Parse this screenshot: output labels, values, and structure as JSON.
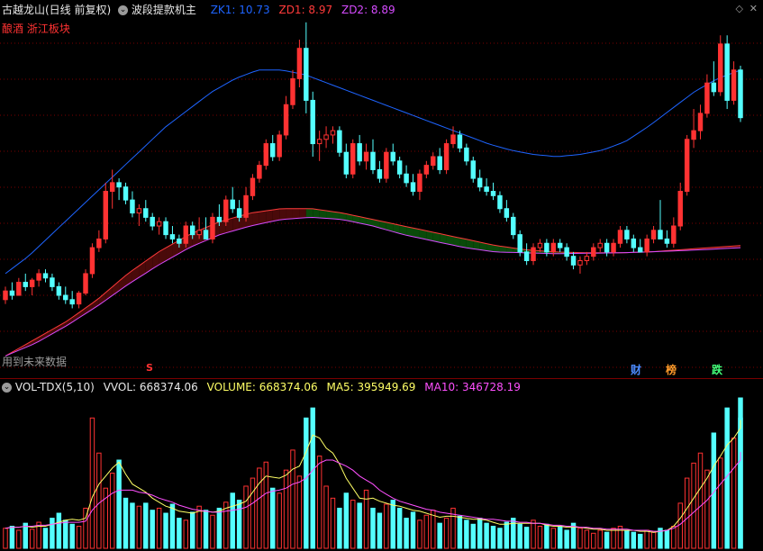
{
  "main_header": {
    "stock_title": "古越龙山(日线 前复权)",
    "indicator_name": "波段提款机主",
    "zk1_label": "ZK1: ",
    "zk1_value": "10.73",
    "zd1_label": "ZD1: ",
    "zd1_value": "8.97",
    "zd2_label": "ZD2: ",
    "zd2_value": "8.89",
    "sector_tag": "酿酒 浙江板块",
    "footnote": "用到未来数据",
    "marker_s": "S"
  },
  "event_badges": [
    {
      "label": "财",
      "color": "#4b8bff"
    },
    {
      "label": "榜",
      "color": "#ff9a2a"
    },
    {
      "label": "跌",
      "color": "#43ff7a"
    }
  ],
  "volume_header": {
    "name": "VOL-TDX(5,10)",
    "vvol_label": "VVOL: ",
    "vvol_value": "668374.06",
    "volume_label": "VOLUME: ",
    "volume_value": "668374.06",
    "ma5_label": "MA5: ",
    "ma5_value": "395949.69",
    "ma10_label": "MA10: ",
    "ma10_value": "346728.19"
  },
  "colors": {
    "up": "#ff3232",
    "down": "#54ffff",
    "zk1": "#1e64ff",
    "zd1": "#ff3a3a",
    "zd2": "#d64bff",
    "ma5": "#ffff66",
    "ma10": "#ff50ff",
    "band_up": "#4a0a0a",
    "band_down": "#0a4a0a",
    "grid": "#7a0000"
  },
  "chart_data": {
    "type": "candlestick",
    "candles": [
      [
        5.9,
        6.2,
        5.8,
        6.1
      ],
      [
        6.1,
        6.3,
        5.9,
        6.0
      ],
      [
        6.0,
        6.4,
        6.0,
        6.3
      ],
      [
        6.3,
        6.5,
        6.1,
        6.2
      ],
      [
        6.2,
        6.4,
        6.0,
        6.35
      ],
      [
        6.35,
        6.6,
        6.2,
        6.5
      ],
      [
        6.5,
        6.6,
        6.3,
        6.4
      ],
      [
        6.4,
        6.5,
        6.1,
        6.2
      ],
      [
        6.2,
        6.3,
        5.9,
        6.0
      ],
      [
        6.0,
        6.2,
        5.8,
        5.9
      ],
      [
        5.9,
        6.1,
        5.7,
        5.8
      ],
      [
        5.8,
        6.1,
        5.7,
        6.05
      ],
      [
        6.05,
        6.6,
        6.0,
        6.5
      ],
      [
        6.5,
        7.2,
        6.4,
        7.1
      ],
      [
        7.1,
        7.5,
        7.0,
        7.3
      ],
      [
        7.3,
        8.6,
        7.2,
        8.4
      ],
      [
        8.4,
        8.9,
        8.0,
        8.6
      ],
      [
        8.6,
        8.7,
        8.2,
        8.5
      ],
      [
        8.5,
        8.6,
        8.1,
        8.2
      ],
      [
        8.2,
        8.4,
        7.8,
        7.9
      ],
      [
        7.9,
        8.1,
        7.6,
        8.0
      ],
      [
        8.0,
        8.2,
        7.7,
        7.8
      ],
      [
        7.8,
        7.9,
        7.5,
        7.6
      ],
      [
        7.6,
        7.8,
        7.4,
        7.7
      ],
      [
        7.7,
        7.8,
        7.3,
        7.4
      ],
      [
        7.4,
        7.6,
        7.2,
        7.3
      ],
      [
        7.3,
        7.4,
        7.1,
        7.2
      ],
      [
        7.2,
        7.7,
        7.1,
        7.6
      ],
      [
        7.6,
        7.7,
        7.3,
        7.4
      ],
      [
        7.4,
        7.8,
        7.3,
        7.5
      ],
      [
        7.5,
        7.8,
        7.4,
        7.3
      ],
      [
        7.3,
        7.9,
        7.2,
        7.8
      ],
      [
        7.8,
        8.1,
        7.6,
        7.7
      ],
      [
        7.7,
        8.3,
        7.6,
        8.2
      ],
      [
        8.2,
        8.5,
        7.9,
        8.0
      ],
      [
        8.0,
        8.2,
        7.7,
        7.8
      ],
      [
        7.8,
        8.5,
        7.7,
        8.3
      ],
      [
        8.3,
        8.8,
        8.2,
        8.7
      ],
      [
        8.7,
        9.1,
        8.6,
        9.0
      ],
      [
        9.0,
        9.6,
        8.9,
        9.5
      ],
      [
        9.5,
        9.7,
        9.1,
        9.2
      ],
      [
        9.2,
        9.8,
        9.1,
        9.7
      ],
      [
        9.7,
        10.6,
        9.6,
        10.4
      ],
      [
        10.4,
        11.2,
        10.3,
        11.0
      ],
      [
        11.0,
        11.9,
        10.8,
        11.7
      ],
      [
        11.7,
        12.3,
        10.2,
        10.5
      ],
      [
        10.5,
        10.7,
        9.2,
        9.5
      ],
      [
        9.5,
        9.8,
        9.1,
        9.6
      ],
      [
        9.6,
        9.9,
        9.4,
        9.7
      ],
      [
        9.7,
        9.9,
        9.5,
        9.8
      ],
      [
        9.8,
        9.9,
        9.2,
        9.3
      ],
      [
        9.3,
        9.5,
        8.7,
        8.8
      ],
      [
        8.8,
        9.6,
        8.7,
        9.5
      ],
      [
        9.5,
        9.7,
        9.0,
        9.1
      ],
      [
        9.1,
        9.5,
        8.9,
        9.3
      ],
      [
        9.3,
        9.6,
        8.8,
        8.9
      ],
      [
        8.9,
        9.1,
        8.6,
        8.7
      ],
      [
        8.7,
        9.4,
        8.6,
        9.3
      ],
      [
        9.3,
        9.5,
        9.0,
        9.1
      ],
      [
        9.1,
        9.2,
        8.7,
        8.8
      ],
      [
        8.8,
        9.0,
        8.5,
        8.6
      ],
      [
        8.6,
        8.8,
        8.3,
        8.4
      ],
      [
        8.4,
        8.9,
        8.2,
        8.8
      ],
      [
        8.8,
        9.1,
        8.7,
        9.0
      ],
      [
        9.0,
        9.3,
        8.9,
        9.2
      ],
      [
        9.2,
        9.4,
        8.8,
        8.9
      ],
      [
        8.9,
        9.6,
        8.8,
        9.5
      ],
      [
        9.5,
        9.9,
        9.4,
        9.7
      ],
      [
        9.7,
        9.8,
        9.3,
        9.4
      ],
      [
        9.4,
        9.5,
        9.0,
        9.1
      ],
      [
        9.1,
        9.2,
        8.6,
        8.7
      ],
      [
        8.7,
        8.9,
        8.4,
        8.5
      ],
      [
        8.5,
        8.7,
        8.3,
        8.4
      ],
      [
        8.4,
        8.6,
        8.2,
        8.3
      ],
      [
        8.3,
        8.4,
        7.9,
        8.0
      ],
      [
        8.0,
        8.2,
        7.7,
        7.8
      ],
      [
        7.8,
        7.9,
        7.3,
        7.4
      ],
      [
        7.4,
        7.5,
        6.9,
        7.0
      ],
      [
        7.0,
        7.2,
        6.7,
        6.8
      ],
      [
        6.8,
        7.2,
        6.7,
        7.1
      ],
      [
        7.1,
        7.3,
        7.0,
        7.2
      ],
      [
        7.2,
        7.3,
        6.9,
        7.0
      ],
      [
        7.0,
        7.3,
        6.9,
        7.2
      ],
      [
        7.2,
        7.3,
        7.0,
        7.1
      ],
      [
        7.1,
        7.2,
        6.8,
        6.9
      ],
      [
        6.9,
        7.0,
        6.6,
        6.7
      ],
      [
        6.7,
        6.9,
        6.5,
        6.8
      ],
      [
        6.8,
        7.0,
        6.7,
        6.9
      ],
      [
        6.9,
        7.2,
        6.8,
        7.1
      ],
      [
        7.1,
        7.3,
        7.0,
        7.2
      ],
      [
        7.2,
        7.3,
        6.9,
        7.0
      ],
      [
        7.0,
        7.3,
        6.9,
        7.2
      ],
      [
        7.2,
        7.6,
        7.1,
        7.5
      ],
      [
        7.5,
        7.6,
        7.2,
        7.3
      ],
      [
        7.3,
        7.4,
        7.0,
        7.1
      ],
      [
        7.1,
        7.3,
        7.0,
        7.0
      ],
      [
        7.0,
        7.4,
        6.9,
        7.3
      ],
      [
        7.3,
        7.6,
        7.2,
        7.5
      ],
      [
        7.5,
        8.2,
        7.4,
        7.3
      ],
      [
        7.3,
        7.5,
        7.1,
        7.2
      ],
      [
        7.2,
        7.8,
        7.1,
        7.6
      ],
      [
        7.6,
        8.6,
        7.5,
        8.4
      ],
      [
        8.4,
        9.7,
        8.3,
        9.6
      ],
      [
        9.6,
        10.3,
        9.4,
        9.8
      ],
      [
        9.8,
        10.4,
        9.6,
        10.2
      ],
      [
        10.2,
        11.1,
        10.1,
        10.9
      ],
      [
        10.9,
        11.4,
        10.6,
        10.7
      ],
      [
        10.7,
        12.0,
        10.6,
        11.8
      ],
      [
        11.8,
        12.0,
        10.3,
        10.5
      ],
      [
        10.5,
        11.4,
        10.4,
        11.2
      ],
      [
        11.2,
        11.3,
        10.0,
        10.1
      ]
    ],
    "zk1": [
      6.5,
      6.9,
      7.4,
      7.9,
      8.4,
      8.9,
      9.4,
      9.9,
      10.3,
      10.7,
      11.0,
      11.2,
      11.2,
      11.1,
      10.9,
      10.7,
      10.5,
      10.3,
      10.1,
      9.9,
      9.7,
      9.5,
      9.35,
      9.25,
      9.2,
      9.25,
      9.35,
      9.55,
      9.9,
      10.3,
      10.7,
      11.0,
      11.2
    ],
    "zd1": [
      4.6,
      5.0,
      5.4,
      5.9,
      6.5,
      7.0,
      7.4,
      7.7,
      7.9,
      8.0,
      8.0,
      7.9,
      7.75,
      7.6,
      7.45,
      7.3,
      7.15,
      7.05,
      7.0,
      6.98,
      6.98,
      7.0,
      7.05,
      7.1,
      7.15
    ],
    "zd2": [
      4.6,
      4.9,
      5.3,
      5.75,
      6.25,
      6.7,
      7.1,
      7.4,
      7.6,
      7.75,
      7.8,
      7.75,
      7.6,
      7.4,
      7.25,
      7.1,
      7.0,
      6.98,
      6.96,
      6.97,
      6.98,
      7.0,
      7.03,
      7.06,
      7.1
    ],
    "volumes": [
      20,
      22,
      18,
      25,
      19,
      26,
      20,
      30,
      35,
      28,
      24,
      22,
      40,
      130,
      95,
      60,
      75,
      88,
      50,
      45,
      42,
      45,
      38,
      40,
      35,
      44,
      30,
      28,
      36,
      42,
      38,
      33,
      40,
      46,
      55,
      48,
      62,
      70,
      80,
      86,
      60,
      55,
      78,
      98,
      72,
      130,
      140,
      92,
      62,
      50,
      40,
      55,
      48,
      45,
      58,
      40,
      35,
      44,
      48,
      40,
      30,
      36,
      28,
      33,
      38,
      25,
      30,
      40,
      32,
      28,
      24,
      30,
      25,
      22,
      20,
      26,
      30,
      24,
      21,
      28,
      22,
      24,
      20,
      22,
      18,
      25,
      20,
      18,
      15,
      18,
      16,
      20,
      22,
      18,
      16,
      14,
      18,
      16,
      20,
      18,
      22,
      45,
      70,
      85,
      95,
      78,
      115,
      90,
      140,
      110,
      150,
      130
    ],
    "ma5": [
      20,
      21,
      21,
      22,
      21,
      22,
      22,
      24,
      26,
      28,
      29,
      28,
      30,
      51,
      64,
      72,
      80,
      86,
      74,
      64,
      60,
      56,
      50,
      46,
      42,
      40,
      37,
      36,
      35,
      37,
      37,
      36,
      37,
      40,
      42,
      44,
      47,
      56,
      65,
      72,
      71,
      70,
      73,
      79,
      82,
      96,
      113,
      110,
      100,
      95,
      84,
      70,
      60,
      50,
      49,
      50,
      47,
      45,
      43,
      42,
      40,
      38,
      37,
      35,
      33,
      31,
      32,
      32,
      31,
      30,
      29,
      29,
      28,
      26,
      24,
      24,
      25,
      25,
      25,
      25,
      25,
      23,
      22,
      22,
      21,
      21,
      21,
      20,
      19,
      19,
      18,
      18,
      18,
      18,
      18,
      17,
      17,
      16,
      17,
      18,
      22,
      30,
      40,
      50,
      60,
      70,
      82,
      92,
      103,
      110,
      120,
      128
    ],
    "ma10": [
      20,
      21,
      21,
      22,
      22,
      23,
      23,
      24,
      25,
      26,
      26,
      26,
      27,
      38,
      45,
      50,
      55,
      58,
      58,
      58,
      56,
      55,
      53,
      50,
      48,
      46,
      43,
      41,
      39,
      38,
      37,
      36,
      36,
      37,
      38,
      39,
      41,
      45,
      50,
      55,
      57,
      58,
      60,
      64,
      66,
      70,
      78,
      85,
      88,
      88,
      85,
      82,
      78,
      72,
      68,
      64,
      58,
      54,
      50,
      47,
      45,
      43,
      41,
      39,
      38,
      36,
      35,
      34,
      33,
      32,
      31,
      30,
      29,
      29,
      28,
      27,
      27,
      26,
      26,
      25,
      25,
      24,
      23,
      23,
      22,
      22,
      21,
      21,
      20,
      20,
      19,
      19,
      19,
      19,
      18,
      18,
      18,
      17,
      17,
      18,
      20,
      24,
      30,
      36,
      42,
      48,
      56,
      64,
      72,
      80,
      88,
      96
    ]
  }
}
